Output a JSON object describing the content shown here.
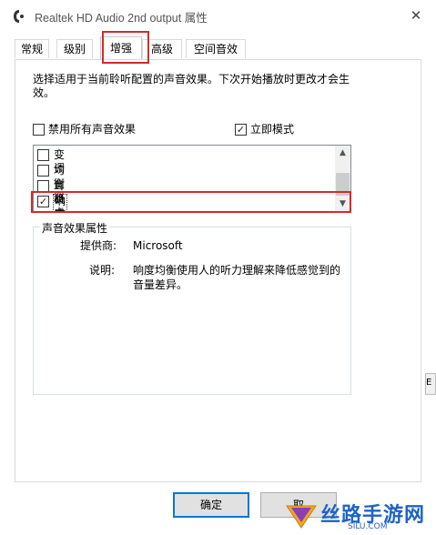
{
  "window": {
    "title": "Realtek HD Audio 2nd output 属性"
  },
  "tabs": [
    {
      "label": "常规",
      "active": false
    },
    {
      "label": "级别",
      "active": false
    },
    {
      "label": "增强",
      "active": true
    },
    {
      "label": "高级",
      "active": false
    },
    {
      "label": "空间音效",
      "active": false
    }
  ],
  "description": "选择适用于当前聆听配置的声音效果。下次开始播放时更改才会生效。",
  "disable_all": {
    "label": "禁用所有声音效果",
    "checked": false
  },
  "immediate_mode": {
    "label": "立即模式",
    "checked": true
  },
  "effects": [
    {
      "label": "变调",
      "checked": false
    },
    {
      "label": "均衡器",
      "checked": false
    },
    {
      "label": "耳机虚拟化",
      "checked": false
    },
    {
      "label": "响度均衡",
      "checked": true
    }
  ],
  "properties": {
    "title": "声音效果属性",
    "provider_label": "提供商:",
    "provider_value": "Microsoft",
    "desc_label": "说明:",
    "desc_value": "响度均衡使用人的听力理解来降低感觉到的音量差异。"
  },
  "buttons": {
    "ok": "确定",
    "cancel": "取"
  },
  "edge_fragment": "E",
  "watermark": {
    "text": "丝路手游网",
    "sub": "SILU.COM"
  },
  "colors": {
    "highlight": "#d62a2a",
    "accent": "#0078d7"
  }
}
